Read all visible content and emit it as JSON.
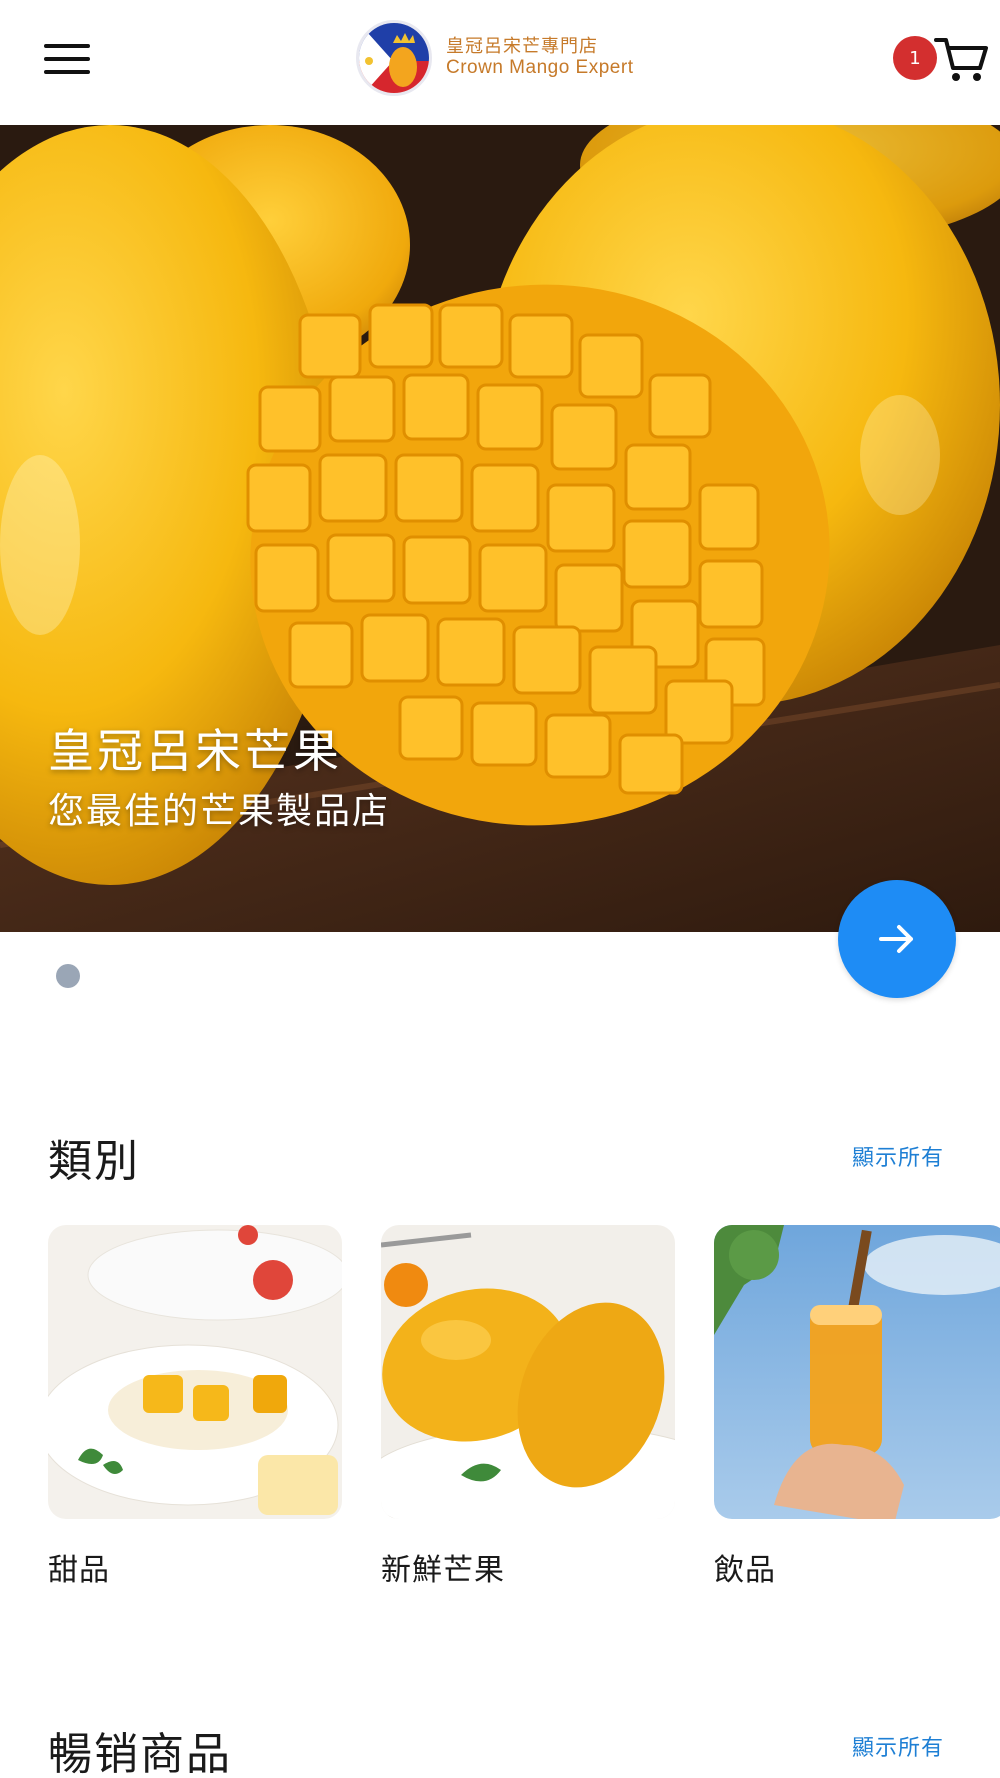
{
  "header": {
    "logo_cn": "皇冠呂宋芒專門店",
    "logo_en": "Crown Mango Expert",
    "cart_count": "1"
  },
  "hero": {
    "title": "皇冠呂宋芒果",
    "subtitle": "您最佳的芒果製品店"
  },
  "categories": {
    "title": "類別",
    "show_all": "顯示所有",
    "items": [
      {
        "label": "甜品"
      },
      {
        "label": "新鮮芒果"
      },
      {
        "label": "飲品"
      }
    ]
  },
  "bestsellers": {
    "title": "暢销商品",
    "show_all": "顯示所有"
  },
  "colors": {
    "accent": "#1e8cf5",
    "link": "#1e7fd4",
    "badge": "#d32f2f",
    "logo_text": "#c67a2a"
  }
}
